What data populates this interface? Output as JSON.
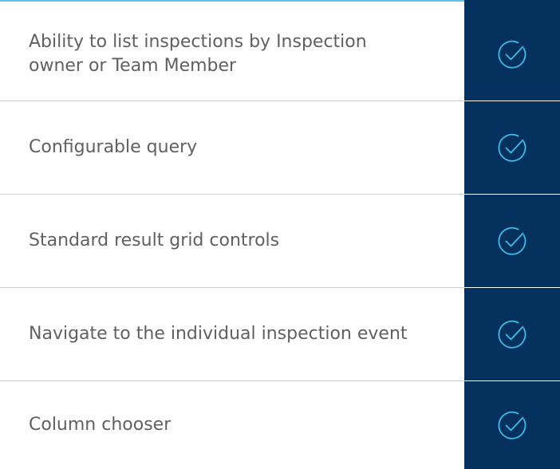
{
  "colors": {
    "accent_rule": "#5ec3e6",
    "check_column": "#04315e",
    "check_icon": "#3fb9e6",
    "text": "#606060",
    "divider": "#cfcfcf"
  },
  "features": [
    {
      "label": "Ability to list inspections by Inspection owner or Team Member",
      "icon": "check-circle-icon",
      "checked": true
    },
    {
      "label": "Configurable query",
      "icon": "check-circle-icon",
      "checked": true
    },
    {
      "label": "Standard result grid controls",
      "icon": "check-circle-icon",
      "checked": true
    },
    {
      "label": "Navigate to the individual inspection event",
      "icon": "check-circle-icon",
      "checked": true
    },
    {
      "label": "Column chooser",
      "icon": "check-circle-icon",
      "checked": true
    }
  ]
}
